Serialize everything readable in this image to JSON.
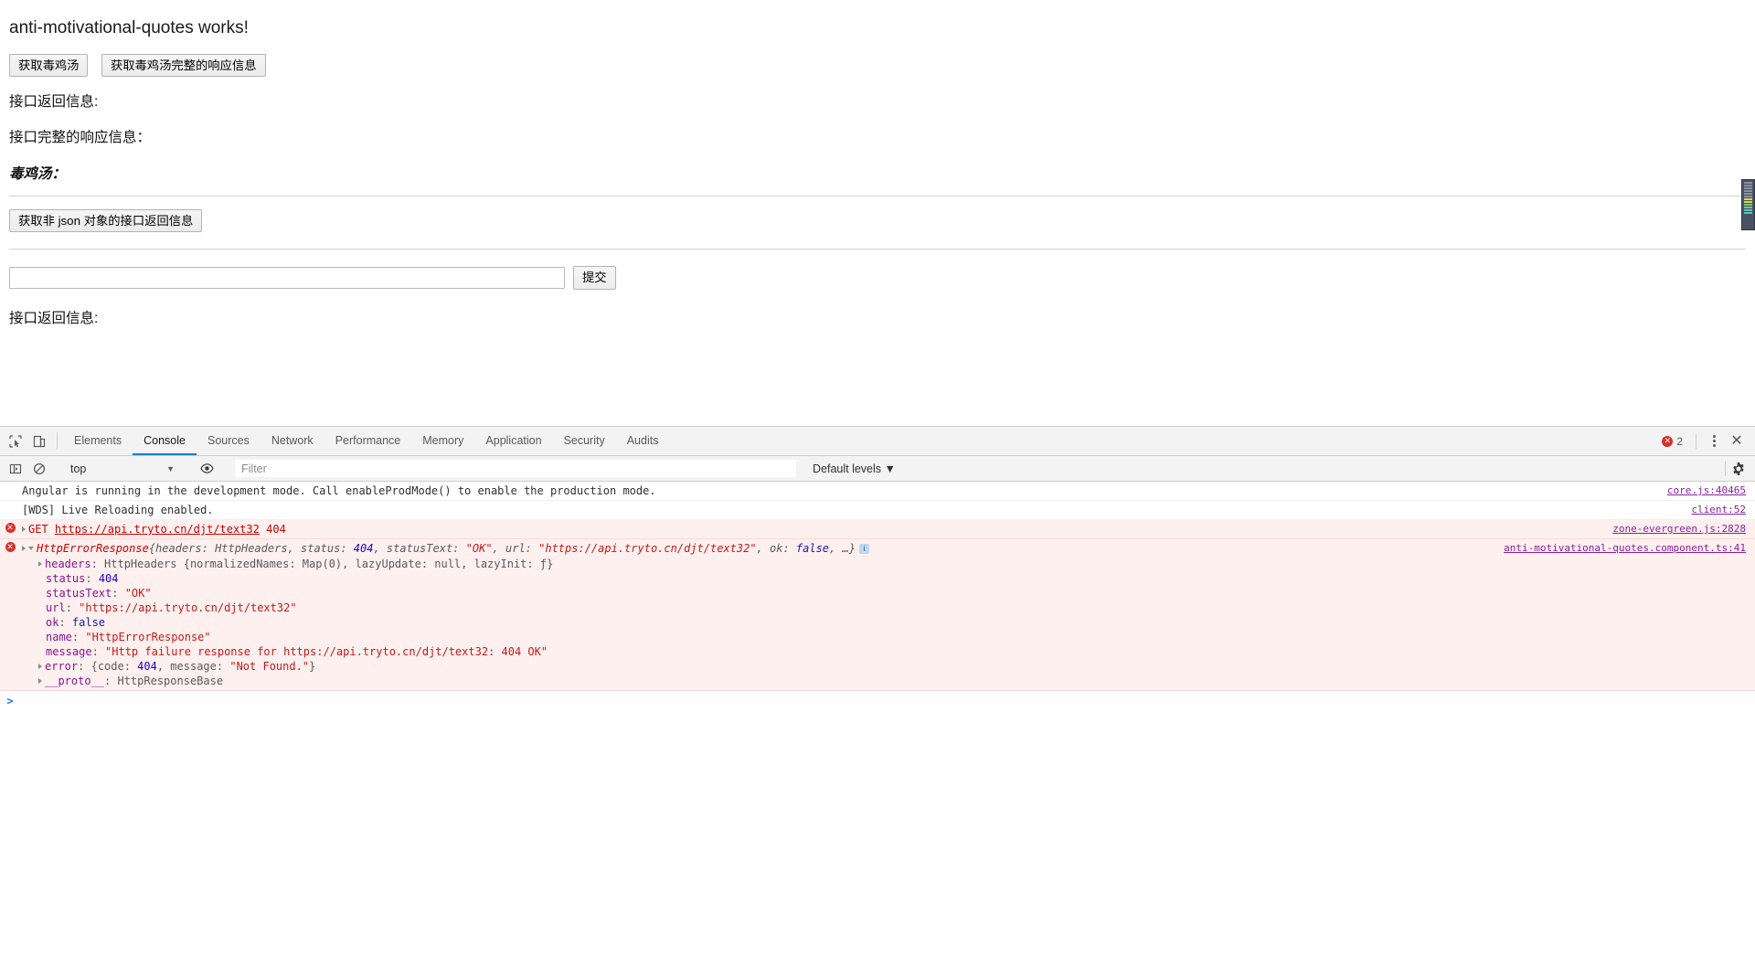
{
  "app": {
    "title": "anti-motivational-quotes works!",
    "buttons": {
      "fetch_quote": "获取毒鸡汤",
      "fetch_full_response": "获取毒鸡汤完整的响应信息",
      "fetch_non_json": "获取非 json 对象的接口返回信息",
      "submit": "提交"
    },
    "labels": {
      "api_return": "接口返回信息:",
      "api_full_response": "接口完整的响应信息：",
      "quote_heading": "毒鸡汤：",
      "api_return_2": "接口返回信息:"
    },
    "input": {
      "value": "",
      "placeholder": ""
    }
  },
  "devtools": {
    "tabs": [
      {
        "label": "Elements",
        "active": false
      },
      {
        "label": "Console",
        "active": true
      },
      {
        "label": "Sources",
        "active": false
      },
      {
        "label": "Network",
        "active": false
      },
      {
        "label": "Performance",
        "active": false
      },
      {
        "label": "Memory",
        "active": false
      },
      {
        "label": "Application",
        "active": false
      },
      {
        "label": "Security",
        "active": false
      },
      {
        "label": "Audits",
        "active": false
      }
    ],
    "error_count": "2",
    "error_badge_glyph": "✕",
    "close_glyph": "✕",
    "toolbar": {
      "context": "top",
      "context_caret": "▼",
      "filter_placeholder": "Filter",
      "filter_value": "",
      "levels": "Default levels ▼"
    },
    "console": {
      "messages": [
        {
          "kind": "log",
          "text": "Angular is running in the development mode. Call enableProdMode() to enable the production mode.",
          "source": "core.js:40465"
        },
        {
          "kind": "log",
          "text": "[WDS] Live Reloading enabled.",
          "source": "client:52"
        },
        {
          "kind": "error-network",
          "method": "GET",
          "url": "https://api.tryto.cn/djt/text32",
          "status": "404",
          "source": "zone-evergreen.js:2828"
        },
        {
          "kind": "error-object",
          "name": "HttpErrorResponse",
          "summary_prefix": "{headers: HttpHeaders, status: ",
          "summary_status": "404",
          "summary_mid": ", statusText: ",
          "summary_statustext": "\"OK\"",
          "summary_url_key": ", url: ",
          "summary_url": "\"https://api.tryto.cn/djt/text32\"",
          "summary_ok_key": ", ok: ",
          "summary_ok": "false",
          "summary_suffix": ", …}",
          "info_glyph": "i",
          "source": "anti-motivational-quotes.component.ts:41",
          "properties": [
            {
              "key": "headers",
              "value": "HttpHeaders {normalizedNames: Map(0), lazyUpdate: null, lazyInit: ƒ}",
              "expandable": true
            },
            {
              "key": "status",
              "value": "404",
              "type": "number",
              "expandable": false
            },
            {
              "key": "statusText",
              "value": "\"OK\"",
              "type": "string",
              "expandable": false
            },
            {
              "key": "url",
              "value": "\"https://api.tryto.cn/djt/text32\"",
              "type": "string",
              "expandable": false
            },
            {
              "key": "ok",
              "value": "false",
              "type": "boolean",
              "expandable": false
            },
            {
              "key": "name",
              "value": "\"HttpErrorResponse\"",
              "type": "string",
              "expandable": false
            },
            {
              "key": "message",
              "value": "\"Http failure response for https://api.tryto.cn/djt/text32: 404 OK\"",
              "type": "string",
              "expandable": false
            },
            {
              "key": "error",
              "value": "{code: 404, message: \"Not Found.\"}",
              "type": "object",
              "expandable": true
            },
            {
              "key": "__proto__",
              "value": "HttpResponseBase",
              "type": "proto",
              "expandable": true
            }
          ]
        }
      ],
      "prompt_caret": ">"
    }
  },
  "colors": {
    "accent": "#1a7bd4",
    "error": "#d93025",
    "error_bg": "#fff0f0",
    "link": "#8a1fa0"
  }
}
